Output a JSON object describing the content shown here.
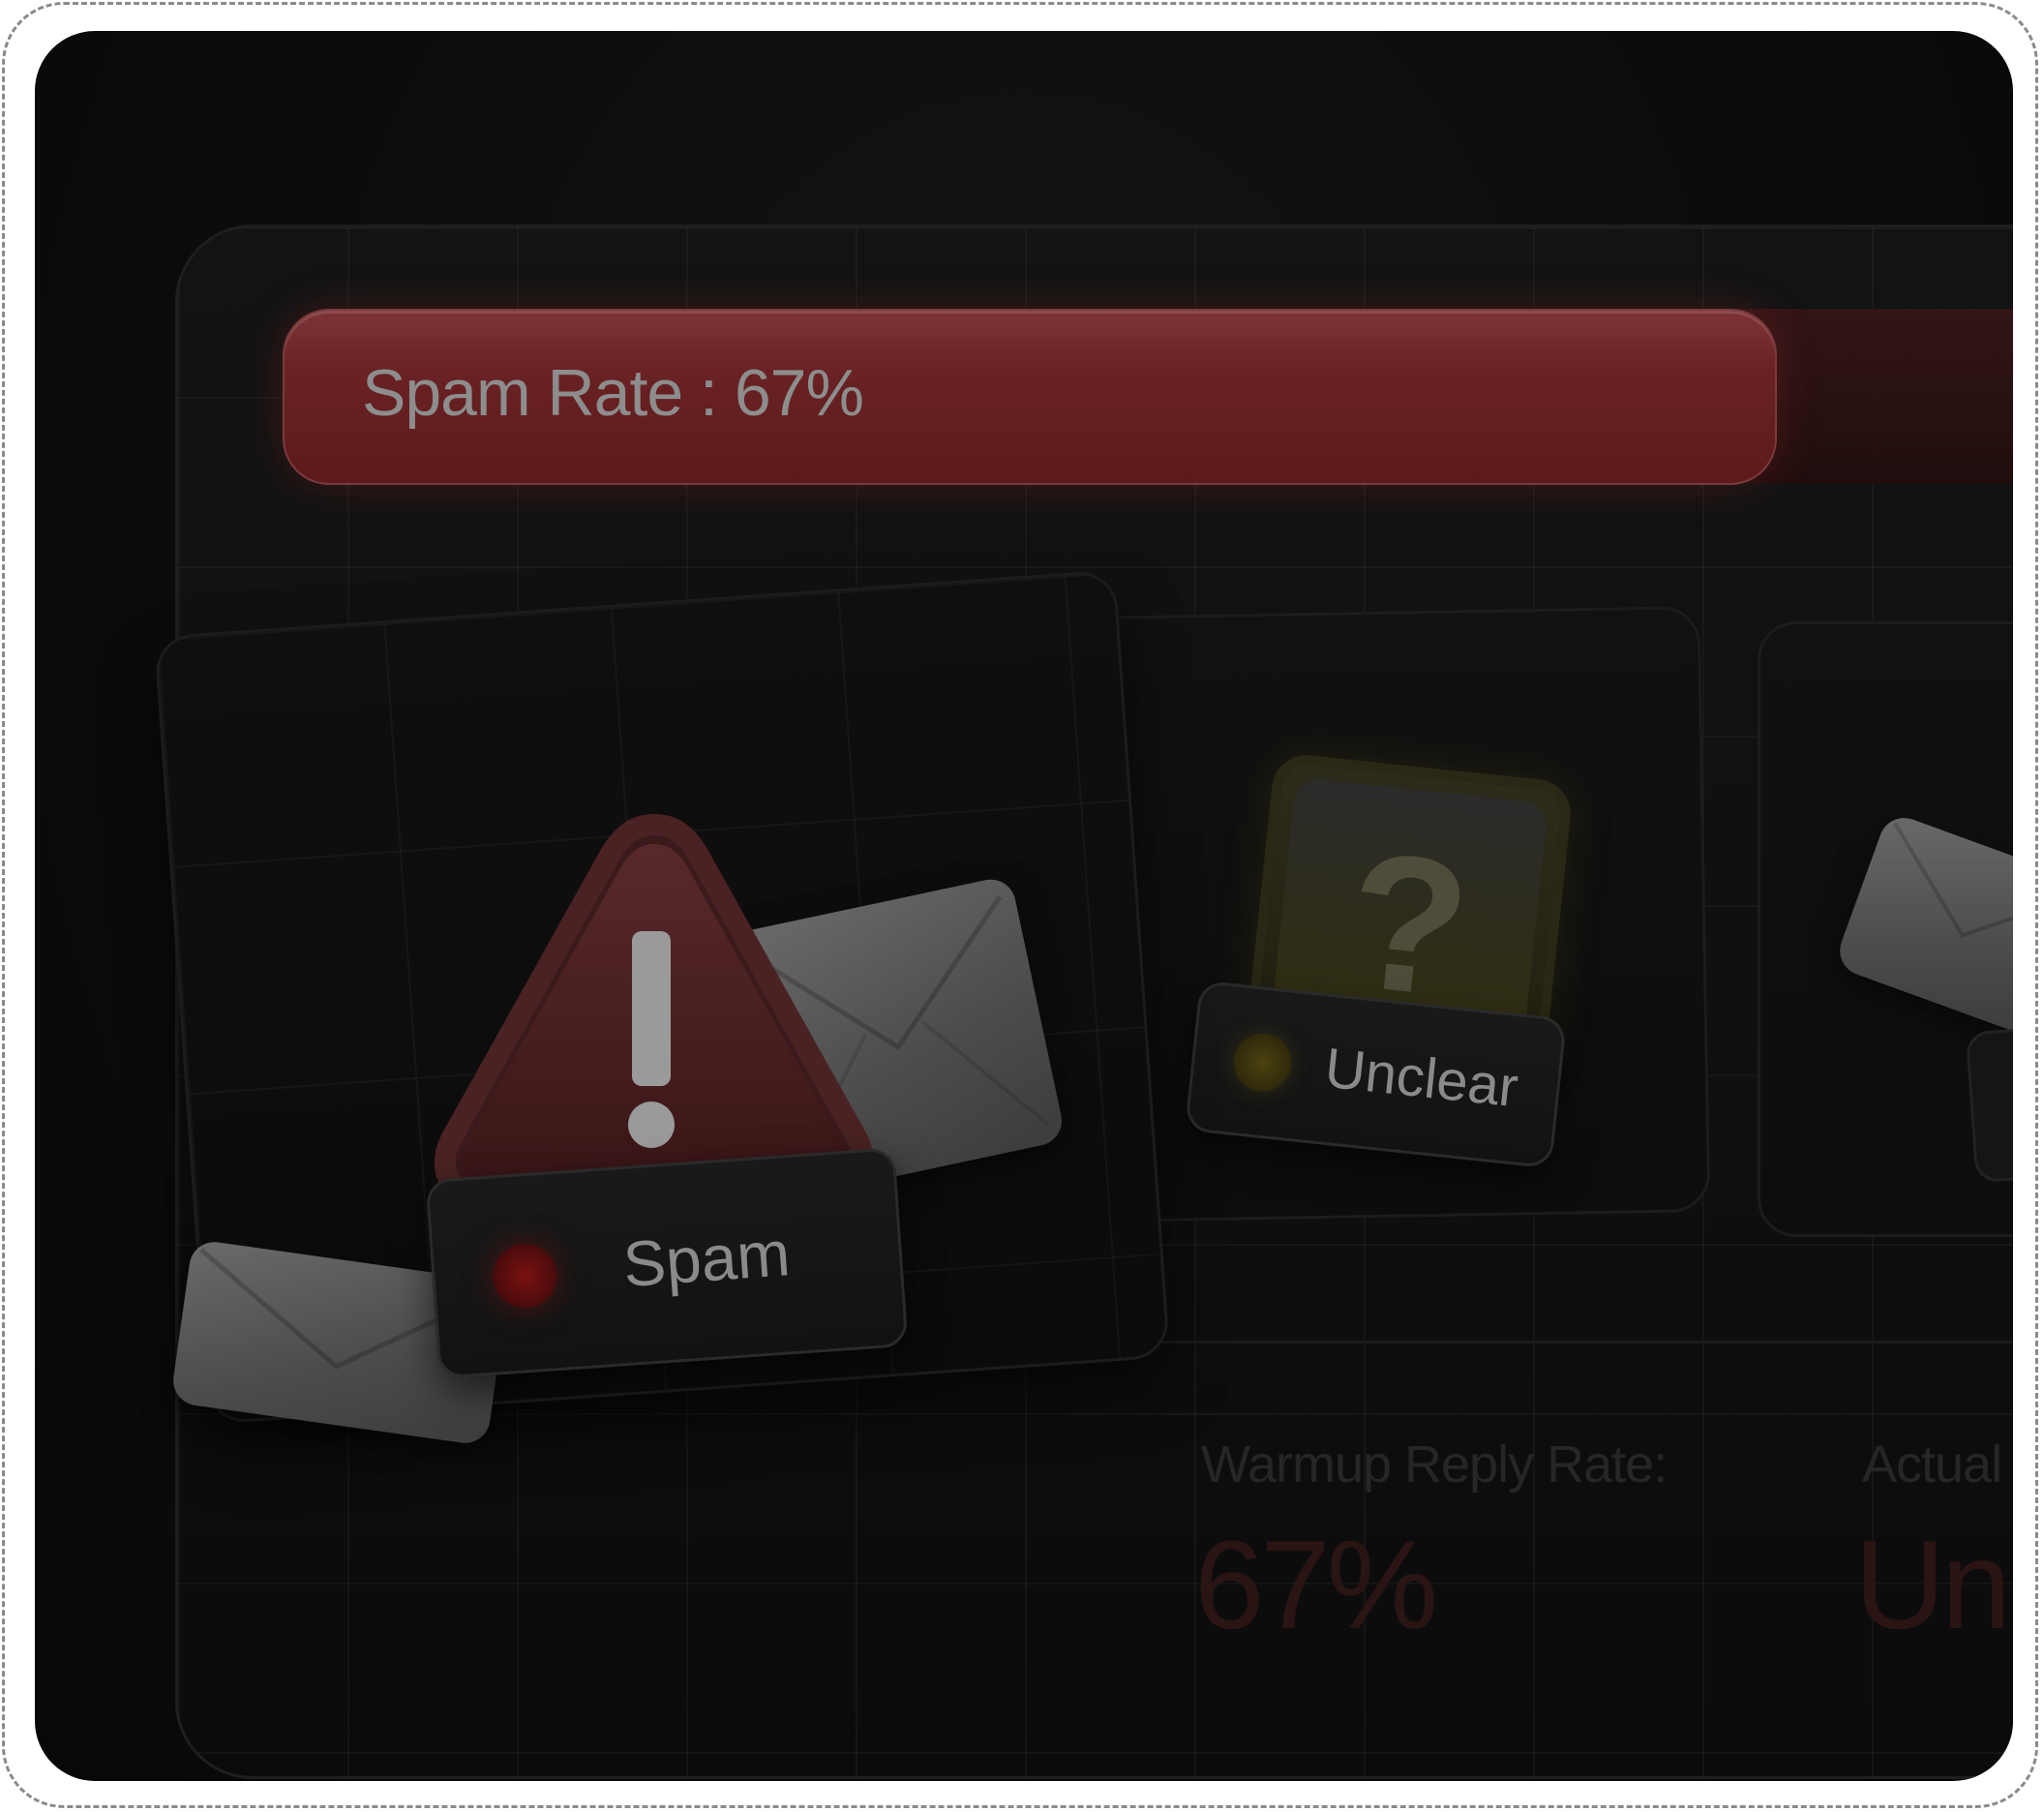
{
  "spam_rate": {
    "label": "Spam Rate : 67%",
    "fill_fraction": 0.67
  },
  "cards": {
    "spam": {
      "tag_label": "Spam",
      "icon": "warning-icon",
      "dot_color": "#7a1212"
    },
    "unclear": {
      "tag_label": "Unclear",
      "icon": "question-mark-icon",
      "dot_color": "#4b4210"
    },
    "third": {
      "icon": "envelope-icon",
      "dot_color": "#1b4a1b"
    }
  },
  "metrics": {
    "warmup_reply_rate": {
      "label": "Warmup Reply Rate:",
      "value": "67%"
    },
    "actual": {
      "label": "Actual In",
      "value": "Unk"
    }
  },
  "colors": {
    "accent_red": "#6a2224",
    "background": "#0c0c0c"
  }
}
